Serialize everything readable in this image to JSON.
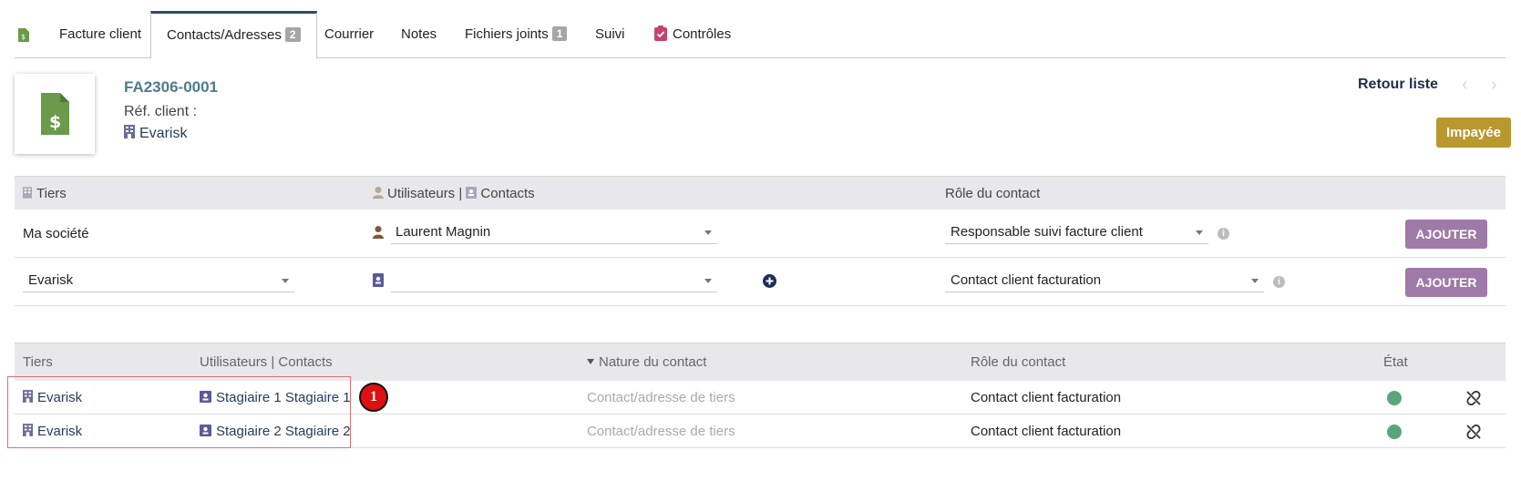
{
  "tabs": [
    {
      "label": "Facture client"
    },
    {
      "label": "Contacts/Adresses",
      "badge": "2"
    },
    {
      "label": "Courrier"
    },
    {
      "label": "Notes"
    },
    {
      "label": "Fichiers joints",
      "badge": "1"
    },
    {
      "label": "Suivi"
    },
    {
      "label": "Contrôles"
    }
  ],
  "header": {
    "ref": "FA2306-0001",
    "ref_client": "Réf. client :",
    "company": "Evarisk",
    "back_list": "Retour liste",
    "status": "Impayée"
  },
  "add_table": {
    "col_tiers": "Tiers",
    "col_users": "Utilisateurs | ",
    "col_contacts": "Contacts",
    "col_role": "Rôle du contact",
    "rows": [
      {
        "tiers": "Ma société",
        "user": "Laurent Magnin",
        "role": "Responsable suivi facture client",
        "button": "AJOUTER"
      },
      {
        "tiers": "Evarisk",
        "user": "",
        "role": "Contact client facturation",
        "button": "AJOUTER"
      }
    ]
  },
  "list_table": {
    "col_tiers": "Tiers",
    "col_users": "Utilisateurs | Contacts",
    "col_nature": "Nature du contact",
    "col_role": "Rôle du contact",
    "col_state": "État",
    "rows": [
      {
        "tiers": "Evarisk",
        "contact": "Stagiaire 1 Stagiaire 1",
        "nature": "Contact/adresse de tiers",
        "role": "Contact client facturation"
      },
      {
        "tiers": "Evarisk",
        "contact": "Stagiaire 2 Stagiaire 2",
        "nature": "Contact/adresse de tiers",
        "role": "Contact client facturation"
      }
    ]
  },
  "annotation": {
    "marker": "1"
  },
  "colors": {
    "status_unpaid": "#b9982f",
    "add_button": "#9f79a8",
    "state_active": "#5aa67a",
    "invoice_icon": "#6a9a4a",
    "highlight": "#e07070"
  },
  "icons": {
    "invoice": "invoice-icon",
    "building": "building-icon",
    "user": "user-icon",
    "contact_card": "contact-card-icon",
    "add": "plus-circle-icon",
    "unlink": "unlink-icon",
    "controls": "clipboard-check-icon"
  }
}
